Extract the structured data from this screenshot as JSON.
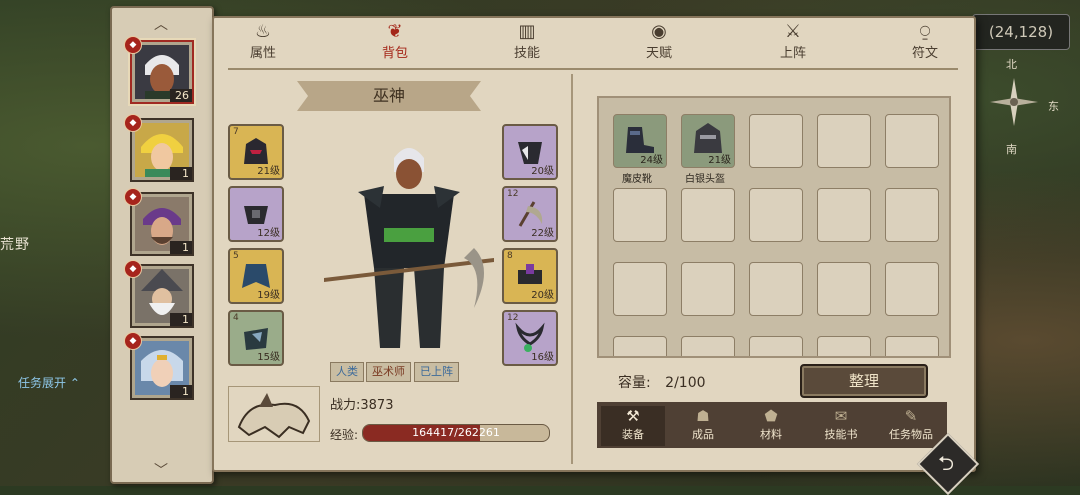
{
  "map": {
    "region_label": "荒野",
    "task_expand": "任务展开",
    "coord": "(24,128)",
    "compass": {
      "north": "北",
      "east": "东",
      "south": "南"
    }
  },
  "heroes": [
    {
      "level": "26",
      "active": true
    },
    {
      "level": "1"
    },
    {
      "level": "1"
    },
    {
      "level": "1"
    },
    {
      "level": "1"
    }
  ],
  "tabs": [
    {
      "label": "属性",
      "icon": "flame-icon"
    },
    {
      "label": "背包",
      "icon": "bag-icon",
      "active": true
    },
    {
      "label": "技能",
      "icon": "book-icon"
    },
    {
      "label": "天赋",
      "icon": "eye-icon"
    },
    {
      "label": "上阵",
      "icon": "crossed-swords-icon"
    },
    {
      "label": "符文",
      "icon": "rune-icon"
    }
  ],
  "hero_name": "巫神",
  "equipment_left": [
    {
      "num": "7",
      "level": "21级",
      "quality": "gold"
    },
    {
      "num": "",
      "level": "12级",
      "quality": "purple"
    },
    {
      "num": "5",
      "level": "19级",
      "quality": "gold"
    },
    {
      "num": "4",
      "level": "15级",
      "quality": "green"
    }
  ],
  "equipment_right": [
    {
      "num": "",
      "level": "20级",
      "quality": "purple"
    },
    {
      "num": "12",
      "level": "22级",
      "quality": "purple"
    },
    {
      "num": "8",
      "level": "20级",
      "quality": "gold"
    },
    {
      "num": "12",
      "level": "16级",
      "quality": "purple"
    }
  ],
  "tags": [
    "人类",
    "巫术师",
    "已上阵"
  ],
  "power": "战力:3873",
  "exp_label": "经验:",
  "exp_value": "164417/262261",
  "exp_progress": 0.627,
  "inventory": {
    "items": [
      {
        "name": "魔皮靴",
        "level": "24级"
      },
      {
        "name": "白银头盔",
        "level": "21级"
      }
    ],
    "capacity_label": "容量:",
    "capacity_value": "2/100",
    "sort_label": "整理"
  },
  "categories": [
    {
      "label": "装备",
      "icon": "hammer-icon",
      "active": true
    },
    {
      "label": "成品",
      "icon": "sack-icon"
    },
    {
      "label": "材料",
      "icon": "ore-icon"
    },
    {
      "label": "技能书",
      "icon": "scroll-icon"
    },
    {
      "label": "任务物品",
      "icon": "quest-scroll-icon"
    }
  ],
  "colors": {
    "accent_red": "#a42618",
    "exp_fill": "#8a2a22",
    "panel_bg": "#e1d6c0"
  }
}
